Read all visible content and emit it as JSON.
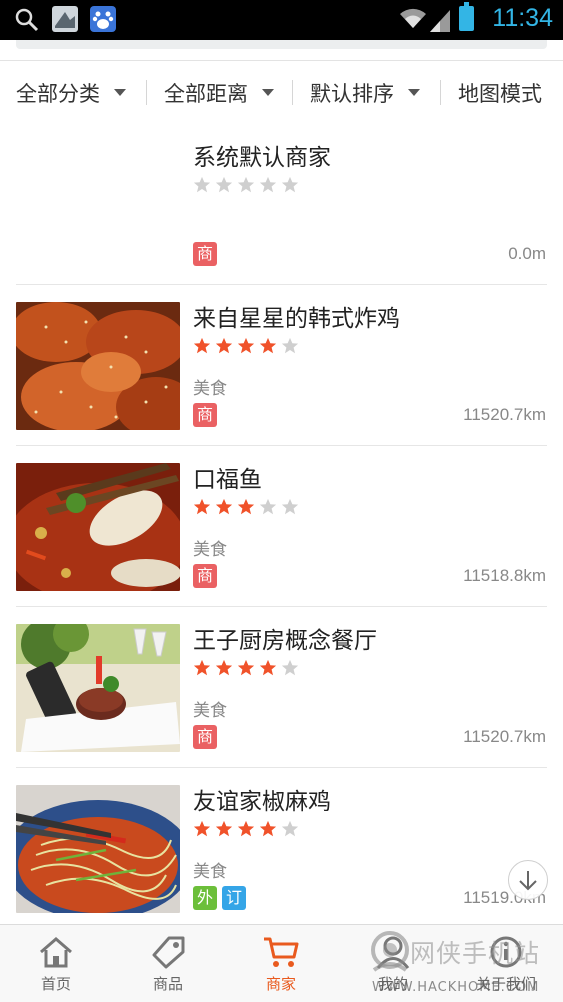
{
  "status_bar": {
    "time": "11:34",
    "icons": [
      "search-icon",
      "app-notification-icon",
      "baidu-icon",
      "wifi-icon",
      "signal-icon",
      "battery-icon"
    ]
  },
  "filters": [
    {
      "label": "全部分类",
      "dropdown": true
    },
    {
      "label": "全部距离",
      "dropdown": true
    },
    {
      "label": "默认排序",
      "dropdown": true
    },
    {
      "label": "地图模式",
      "dropdown": false
    }
  ],
  "merchants": [
    {
      "name": "系统默认商家",
      "rating": 0,
      "category": "",
      "tags": [
        "商"
      ],
      "distance": "0.0m",
      "image": "none"
    },
    {
      "name": "来自星星的韩式炸鸡",
      "rating": 4,
      "category": "美食",
      "tags": [
        "商"
      ],
      "distance": "11520.7km",
      "image": "fried-chicken"
    },
    {
      "name": "口福鱼",
      "rating": 3,
      "category": "美食",
      "tags": [
        "商"
      ],
      "distance": "11518.8km",
      "image": "fish"
    },
    {
      "name": "王子厨房概念餐厅",
      "rating": 4,
      "category": "美食",
      "tags": [
        "商"
      ],
      "distance": "11520.7km",
      "image": "steak"
    },
    {
      "name": "友谊家椒麻鸡",
      "rating": 4,
      "category": "美食",
      "tags": [
        "外",
        "订"
      ],
      "distance": "11519.0km",
      "image": "noodles"
    }
  ],
  "bottom_nav": [
    {
      "label": "首页",
      "icon": "home-icon",
      "active": false
    },
    {
      "label": "商品",
      "icon": "tag-icon",
      "active": false
    },
    {
      "label": "商家",
      "icon": "cart-icon",
      "active": true
    },
    {
      "label": "我的",
      "icon": "user-icon",
      "active": false
    },
    {
      "label": "关于我们",
      "icon": "info-icon",
      "active": false
    }
  ],
  "watermark": {
    "text": "网侠手机站",
    "url": "WWW.HACKHOME.COM"
  },
  "colors": {
    "accent": "#e95a1e",
    "star_on": "#f0522a",
    "star_off": "#cfcfcf",
    "tag_shang": "#ea6163",
    "tag_wai": "#6cbf3a",
    "tag_ding": "#35a5e7",
    "status_time": "#33b5e5"
  }
}
